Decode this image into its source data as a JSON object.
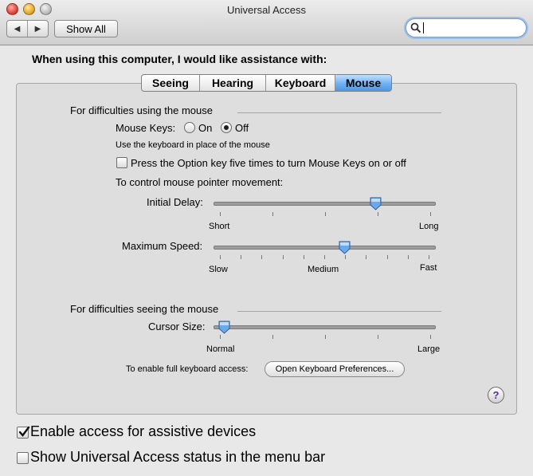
{
  "window": {
    "title": "Universal Access"
  },
  "toolbar": {
    "back_label": "◀",
    "forward_label": "▶",
    "show_all_label": "Show All",
    "search_value": ""
  },
  "heading": "When using this computer, I would like assistance with:",
  "tabs": [
    {
      "label": "Seeing",
      "active": false
    },
    {
      "label": "Hearing",
      "active": false
    },
    {
      "label": "Keyboard",
      "active": false
    },
    {
      "label": "Mouse",
      "active": true
    }
  ],
  "mouse_section": {
    "title": "For difficulties using the mouse",
    "mouse_keys_label": "Mouse Keys:",
    "on_label": "On",
    "off_label": "Off",
    "selected": "Off",
    "hint": "Use the keyboard in place of the mouse",
    "option_key_label": "Press the Option key five times to turn Mouse Keys on or off",
    "option_key_checked": false,
    "control_label": "To control mouse pointer movement:",
    "initial_delay": {
      "label": "Initial Delay:",
      "min_label": "Short",
      "max_label": "Long",
      "value": 0.74
    },
    "max_speed": {
      "label": "Maximum Speed:",
      "min_label": "Slow",
      "mid_label": "Medium",
      "max_label": "Fast",
      "value": 0.59
    }
  },
  "seeing_section": {
    "title": "For difficulties seeing the mouse",
    "cursor_size": {
      "label": "Cursor Size:",
      "min_label": "Normal",
      "max_label": "Large",
      "value": 0.02
    },
    "keyboard_access_label": "To enable full keyboard access:",
    "open_prefs_label": "Open Keyboard Preferences..."
  },
  "help_label": "?",
  "bottom": {
    "assistive_label": "Enable access for assistive devices",
    "assistive_checked": true,
    "status_label": "Show Universal Access status in the menu bar",
    "status_checked": false
  }
}
